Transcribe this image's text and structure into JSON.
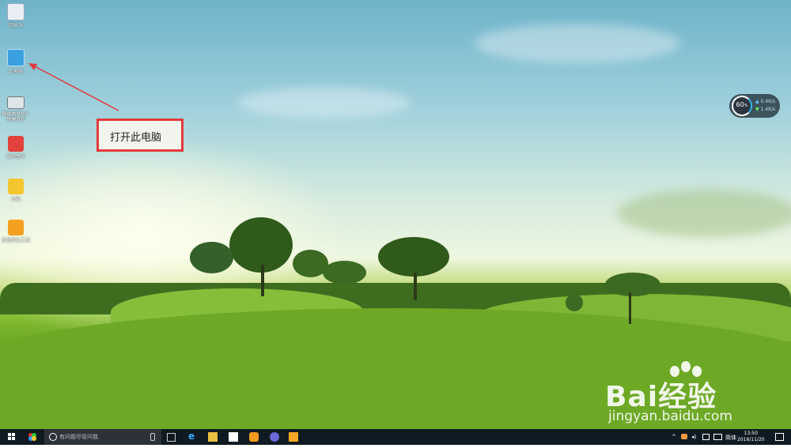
{
  "desktop_icons": [
    {
      "label": "回收站",
      "icon": "recycle-bin-icon"
    },
    {
      "label": "此电脑",
      "icon": "computer-icon"
    },
    {
      "label": "网络共享(B)-快捷方式",
      "icon": "printer-icon"
    },
    {
      "label": "搜狗音乐",
      "icon": "music-app-icon"
    },
    {
      "label": "公告",
      "icon": "folder-icon"
    },
    {
      "label": "系统优化工具",
      "icon": "tool-icon"
    }
  ],
  "annotation": {
    "text": "打开此电脑",
    "border_color": "#e23b3b"
  },
  "network_widget": {
    "percent": "60",
    "percent_unit": "%",
    "up": "0.4K/s",
    "down": "1.4K/s"
  },
  "watermark": {
    "brand": "Bai经验",
    "url": "jingyan.baidu.com"
  },
  "taskbar": {
    "search_placeholder": "有问题尽管问我",
    "apps": [
      "start-icon",
      "cortana-icon",
      "task-view-icon",
      "edge-icon",
      "file-explorer-icon",
      "store-icon",
      "app-icon",
      "browser-icon",
      "document-icon"
    ],
    "ime": "简体",
    "time": "13:50",
    "date": "2016/11/20"
  },
  "colors": {
    "taskbar": "#0f1a22",
    "accent": "#2fb6e8"
  }
}
